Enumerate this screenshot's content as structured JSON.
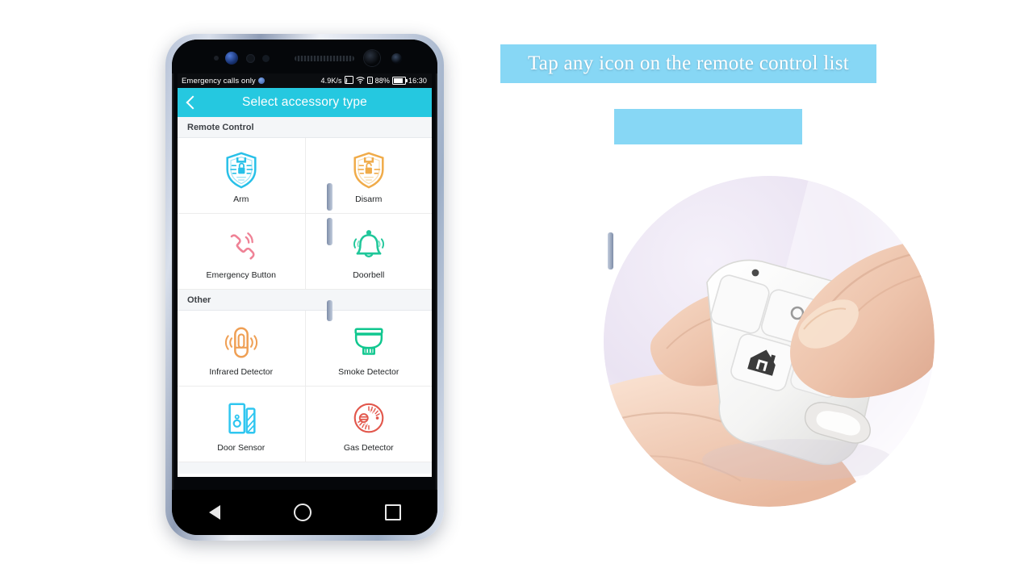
{
  "caption": {
    "line1": "Tap any icon on the remote control list",
    "line2": ""
  },
  "phone": {
    "statusbar": {
      "carrier": "Emergency calls only",
      "globe_icon": "globe-icon",
      "netspeed": "4.9K/s",
      "cast_icon": "cast-icon",
      "wifi_icon": "wifi-icon",
      "sim_icon": "sim-card-icon",
      "battery_pct": "88%",
      "battery_icon": "battery-icon",
      "clock": "16:30"
    },
    "appbar": {
      "back_icon": "chevron-left-icon",
      "title": "Select accessory type",
      "bg_color": "#25c8e0"
    },
    "sections": [
      {
        "title": "Remote Control",
        "items": [
          {
            "label": "Arm",
            "icon": "shield-lock-closed-icon",
            "color": "#28c0e8"
          },
          {
            "label": "Disarm",
            "icon": "shield-lock-open-icon",
            "color": "#f0ab49"
          },
          {
            "label": "Emergency Button",
            "icon": "phone-ringing-icon",
            "color": "#ef8296"
          },
          {
            "label": "Doorbell",
            "icon": "bell-icon",
            "color": "#1fc79a"
          }
        ]
      },
      {
        "title": "Other",
        "items": [
          {
            "label": "Infrared Detector",
            "icon": "motion-sensor-icon",
            "color": "#ef9f54"
          },
          {
            "label": "Smoke Detector",
            "icon": "smoke-alarm-icon",
            "color": "#11c78f"
          },
          {
            "label": "Door Sensor",
            "icon": "door-contact-icon",
            "color": "#2fc6f0"
          },
          {
            "label": "Gas Detector",
            "icon": "gas-alarm-icon",
            "color": "#e2574c"
          }
        ]
      }
    ],
    "navbar": {
      "back": "nav-back-icon",
      "home": "nav-home-icon",
      "recents": "nav-recents-icon"
    }
  },
  "photo": {
    "alt": "hand pressing a button on a white key-fob remote control",
    "bg_color": "#efe9f5"
  }
}
